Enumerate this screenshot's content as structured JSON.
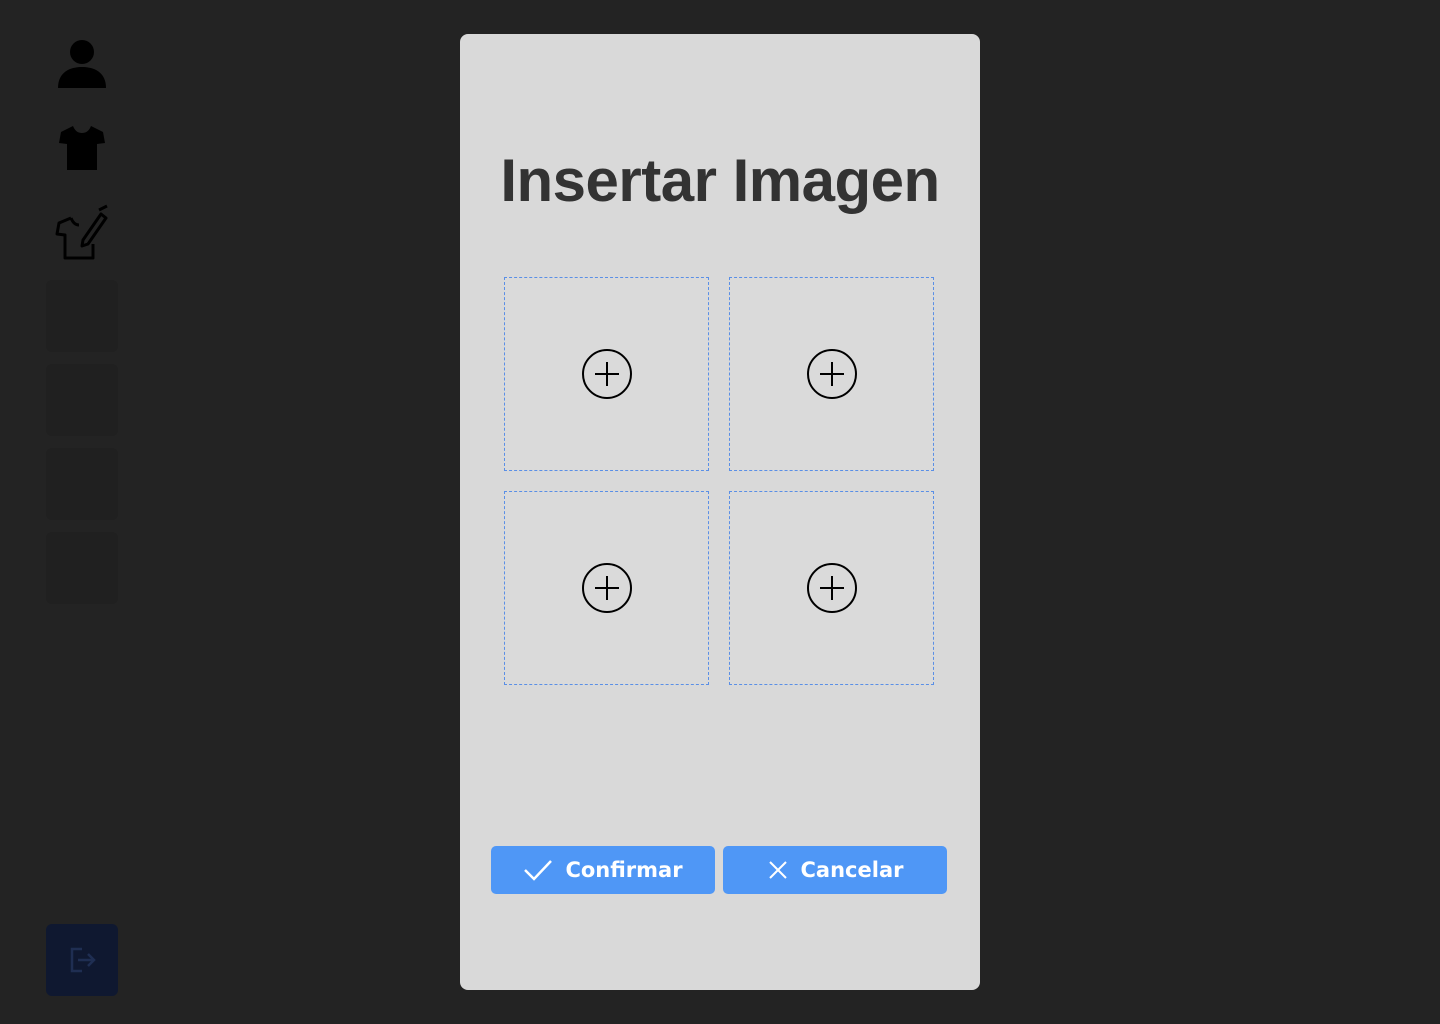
{
  "sidebar": {
    "items": [
      {
        "icon": "user-icon"
      },
      {
        "icon": "tshirt-icon"
      },
      {
        "icon": "tshirt-edit-icon"
      }
    ],
    "logout_icon": "logout-icon"
  },
  "modal": {
    "title": "Insertar Imagen",
    "slots": [
      {
        "icon": "add-circle-icon"
      },
      {
        "icon": "add-circle-icon"
      },
      {
        "icon": "add-circle-icon"
      },
      {
        "icon": "add-circle-icon"
      }
    ],
    "confirm_label": "Confirmar",
    "cancel_label": "Cancelar"
  },
  "colors": {
    "background": "#232323",
    "modal": "#d9d9d9",
    "accent": "#4f97f6",
    "slot_border": "#5a8fe6",
    "title": "#333333"
  }
}
